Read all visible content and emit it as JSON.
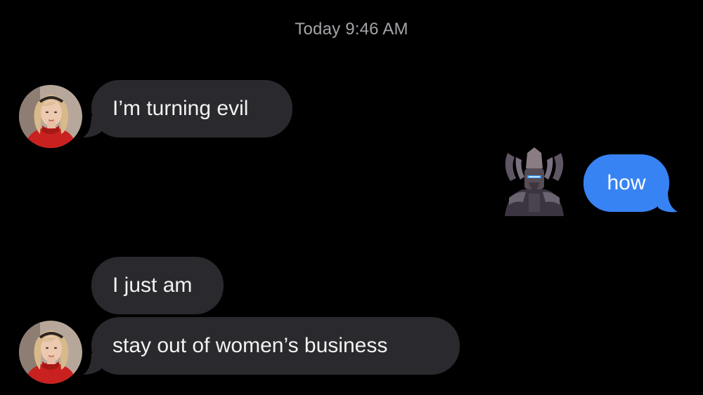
{
  "thread": {
    "timestamp_day": "Today",
    "timestamp_time": "9:46 AM"
  },
  "messages": [
    {
      "id": "m1",
      "direction": "incoming",
      "text": "I’m turning evil"
    },
    {
      "id": "m2",
      "direction": "outgoing",
      "text": "how"
    },
    {
      "id": "m3",
      "direction": "incoming",
      "text": "I just am"
    },
    {
      "id": "m4",
      "direction": "incoming",
      "text": "stay out of women’s business"
    }
  ],
  "colors": {
    "background": "#000000",
    "incoming_bubble": "#2a2a2e",
    "outgoing_bubble": "#3883f3",
    "timestamp_text": "#a4a4a8"
  },
  "icons": {
    "incoming_avatar": "blonde-woman-avatar-icon",
    "outgoing_avatar": "armored-cosmic-figure-icon"
  }
}
